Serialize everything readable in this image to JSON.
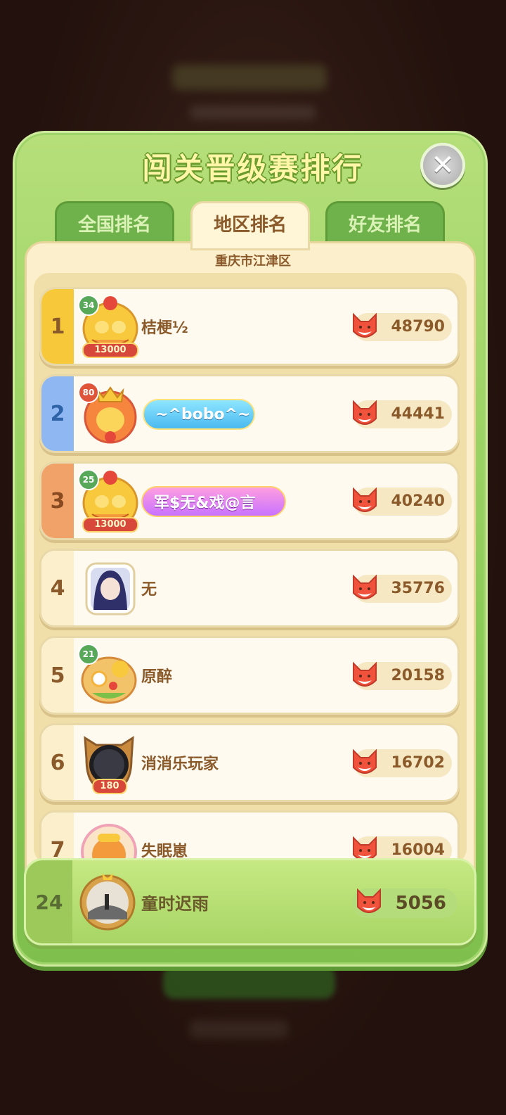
{
  "title": "闯关晋级赛排行",
  "tabs": [
    {
      "label": "全国排名",
      "active": false
    },
    {
      "label": "地区排名",
      "active": true
    },
    {
      "label": "好友排名",
      "active": false
    }
  ],
  "region": "重庆市江津区",
  "rows": [
    {
      "rank": "1",
      "name": "桔梗½",
      "score": "48790",
      "level": "34",
      "frame_label": "13000"
    },
    {
      "rank": "2",
      "name": "~^bobo^~",
      "score": "44441",
      "level": "80"
    },
    {
      "rank": "3",
      "name": "军$无&戏@言",
      "score": "40240",
      "level": "25",
      "frame_label": "13000"
    },
    {
      "rank": "4",
      "name": "无",
      "score": "35776"
    },
    {
      "rank": "5",
      "name": "原醉",
      "score": "20158",
      "level": "21"
    },
    {
      "rank": "6",
      "name": "消消乐玩家",
      "score": "16702",
      "frame_label": "180"
    },
    {
      "rank": "7",
      "name": "失眠崽",
      "score": "16004"
    }
  ],
  "me": {
    "rank": "24",
    "name": "童时迟雨",
    "score": "5056"
  },
  "icons": {
    "close": "close-icon",
    "score": "fox-icon"
  },
  "colors": {
    "panel": "#8ccb58",
    "list": "#fbefcc",
    "gold": "#f7c83a",
    "silver": "#8fb7f2",
    "bronze": "#f0a269"
  }
}
